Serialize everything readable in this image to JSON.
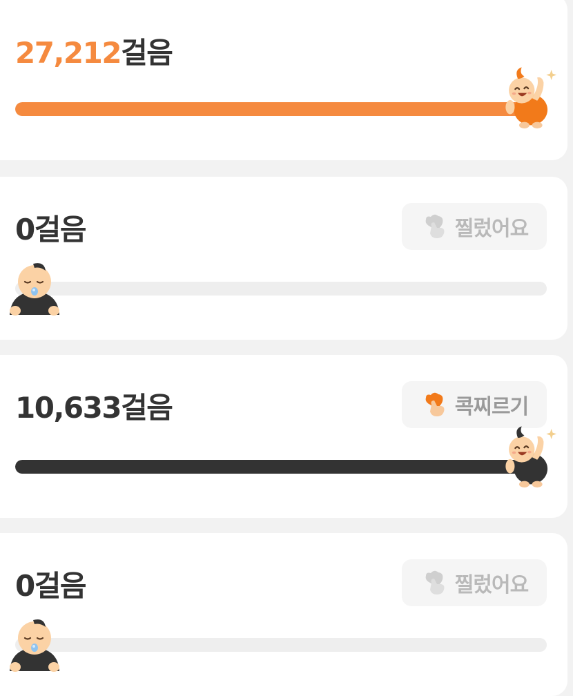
{
  "cards": [
    {
      "steps_number": "27,212",
      "steps_unit": "걸음",
      "progress": 1.0,
      "fill_color": "#f58a3f",
      "mascot": "happy-orange-mascot-icon"
    },
    {
      "steps_label": "0걸음",
      "progress": 0,
      "mascot": "sleeping-mascot-icon",
      "poke": {
        "label": "찔렀어요",
        "state": "done",
        "icon": "poke-hand-icon"
      }
    },
    {
      "steps_label": "10,633걸음",
      "progress": 1.0,
      "fill_color": "#333333",
      "mascot": "happy-black-mascot-icon",
      "poke": {
        "label": "콕찌르기",
        "state": "available",
        "icon": "poke-hand-icon",
        "accent": "#f58a3f"
      }
    },
    {
      "steps_label": "0걸음",
      "progress": 0,
      "mascot": "sleeping-mascot-icon",
      "poke": {
        "label": "찔렀어요",
        "state": "done",
        "icon": "poke-hand-icon"
      }
    }
  ]
}
